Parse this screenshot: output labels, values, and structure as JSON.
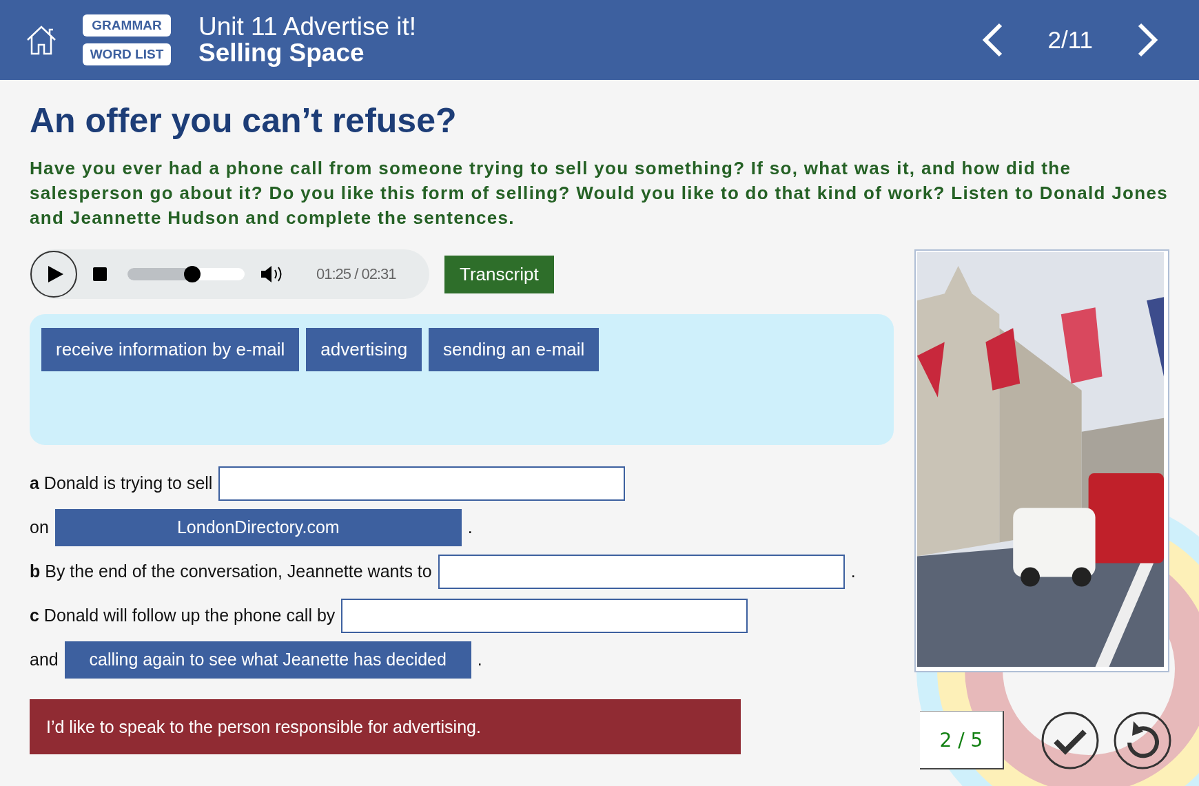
{
  "header": {
    "links": [
      "GRAMMAR",
      "WORD LIST"
    ],
    "unit": "Unit 11 Advertise it!",
    "subtitle": "Selling Space",
    "page": "2/11"
  },
  "title": "An offer you can’t refuse?",
  "instructions": "Have you ever had a phone call from someone trying to sell you something? If so, what was it, and how did the salesperson go about it? Do you like this form of selling? Would you like to do that kind of work? Listen to Donald Jones and Jeannette Hudson and complete the sentences.",
  "audio": {
    "level": 0.55,
    "time": "01:25 / 02:31"
  },
  "transcript_button": "Transcript",
  "word_bank": [
    "receive information by e-mail",
    "advertising",
    "sending an e-mail"
  ],
  "lines": [
    {
      "parts": [
        {
          "kind": "text",
          "text": "**a** Donald is trying to sell"
        },
        {
          "kind": "blank"
        }
      ]
    },
    {
      "parts": [
        {
          "kind": "text",
          "text": "on"
        },
        {
          "kind": "answer",
          "text": "LondonDirectory.com"
        },
        {
          "kind": "text",
          "text": "."
        }
      ]
    },
    {
      "parts": [
        {
          "kind": "text",
          "text": "**b** By the end of the conversation, Jeannette wants to"
        },
        {
          "kind": "blank"
        },
        {
          "kind": "text",
          "text": "."
        }
      ]
    },
    {
      "parts": [
        {
          "kind": "text",
          "text": "**c** Donald will follow up the phone call by"
        },
        {
          "kind": "blank"
        }
      ]
    },
    {
      "parts": [
        {
          "kind": "text",
          "text": "and"
        },
        {
          "kind": "answer",
          "text": "calling again to see what Jeanette has decided"
        },
        {
          "kind": "text",
          "text": "."
        }
      ]
    }
  ],
  "feedback": "I’d like to speak to the person responsible for advertising.",
  "score": "2 / 5"
}
